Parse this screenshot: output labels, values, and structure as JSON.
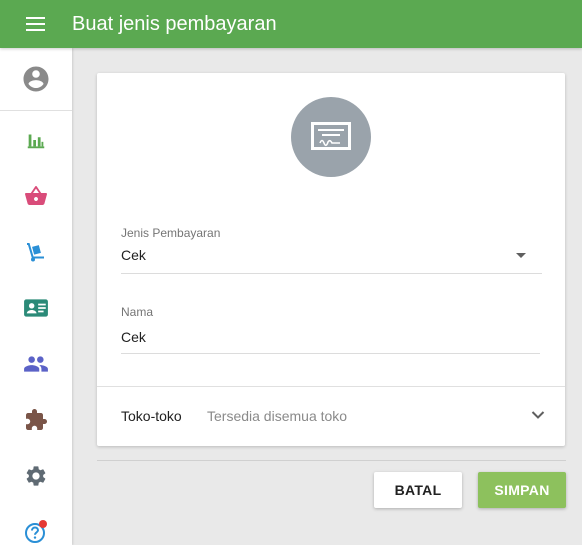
{
  "header": {
    "title": "Buat jenis pembayaran",
    "color": "#5ba951"
  },
  "sidebar": {
    "items": [
      {
        "name": "profile",
        "icon": "account-circle-icon",
        "color": "#8a8a8a"
      },
      {
        "name": "reports",
        "icon": "bar-chart-icon",
        "color": "#5ba951"
      },
      {
        "name": "sales",
        "icon": "basket-icon",
        "color": "#d94c7a"
      },
      {
        "name": "inventory",
        "icon": "dolly-icon",
        "color": "#2a8fd6"
      },
      {
        "name": "employees",
        "icon": "id-card-icon",
        "color": "#2b8a78"
      },
      {
        "name": "customers",
        "icon": "people-icon",
        "color": "#5b62c7"
      },
      {
        "name": "integrations",
        "icon": "puzzle-icon",
        "color": "#7a5548"
      },
      {
        "name": "settings",
        "icon": "gear-icon",
        "color": "#5f6a73"
      },
      {
        "name": "help",
        "icon": "help-icon",
        "color": "#2a8fd6",
        "badge_color": "#e53935"
      }
    ]
  },
  "form": {
    "icon": "check-payment-icon",
    "icon_bg": "#9aa3ab",
    "payment_type": {
      "label": "Jenis Pembayaran",
      "value": "Cek"
    },
    "name": {
      "label": "Nama",
      "value": "Cek"
    },
    "stores": {
      "label": "Toko-toko",
      "value": "Tersedia disemua toko"
    }
  },
  "actions": {
    "cancel_label": "BATAL",
    "save_label": "SIMPAN",
    "save_color": "#8dc15d"
  }
}
